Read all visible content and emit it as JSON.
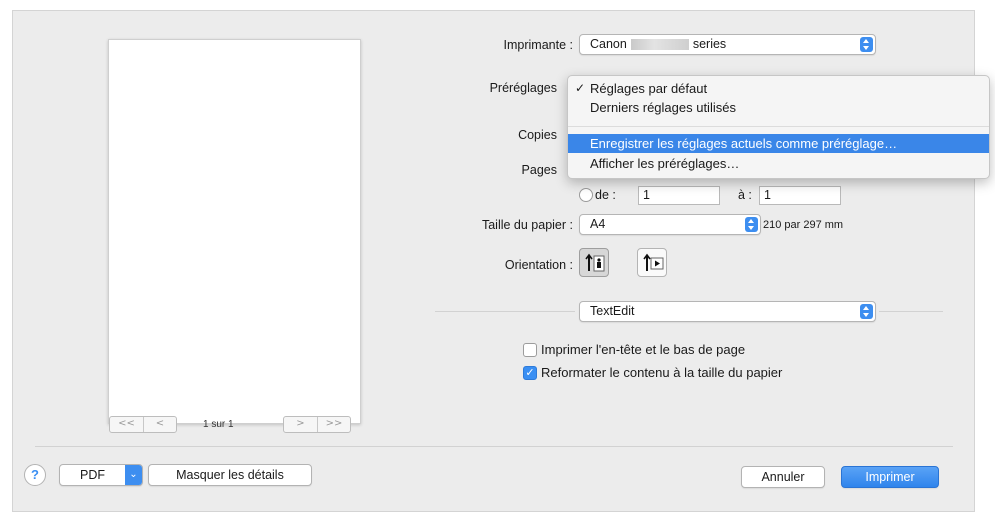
{
  "preview": {
    "page_count": "1 sur 1",
    "nav": {
      "first": "<<",
      "prev": "<",
      "next": ">",
      "last": ">>"
    }
  },
  "printer": {
    "label": "Imprimante :",
    "prefix": "Canon",
    "suffix": "series"
  },
  "presets": {
    "label": "Préréglages",
    "menu": {
      "items": [
        {
          "label": "Réglages par défaut",
          "checked": true
        },
        {
          "label": "Derniers réglages utilisés",
          "checked": false
        },
        {
          "label": "Enregistrer les réglages actuels comme préréglage…",
          "highlighted": true
        },
        {
          "label": "Afficher les préréglages…",
          "checked": false
        }
      ]
    }
  },
  "copies": {
    "label": "Copies"
  },
  "pages": {
    "label": "Pages",
    "from_label": "de :",
    "from_value": "1",
    "to_label": "à :",
    "to_value": "1"
  },
  "paper": {
    "label": "Taille du papier :",
    "value": "A4",
    "dimensions": "210 par 297 mm"
  },
  "orientation": {
    "label": "Orientation :",
    "portrait_icon": "portrait-icon",
    "landscape_icon": "landscape-icon"
  },
  "app_section": {
    "value": "TextEdit"
  },
  "options": {
    "header_footer": {
      "label": "Imprimer l'en-tête et le bas de page",
      "checked": false
    },
    "reformat": {
      "label": "Reformater le contenu à la taille du papier",
      "checked": true
    }
  },
  "footer": {
    "help": "?",
    "pdf": "PDF",
    "hide_details": "Masquer les détails",
    "cancel": "Annuler",
    "print": "Imprimer"
  },
  "colors": {
    "accent": "#3a8ff3",
    "highlight": "#3a86e8",
    "panel": "#ececec"
  }
}
